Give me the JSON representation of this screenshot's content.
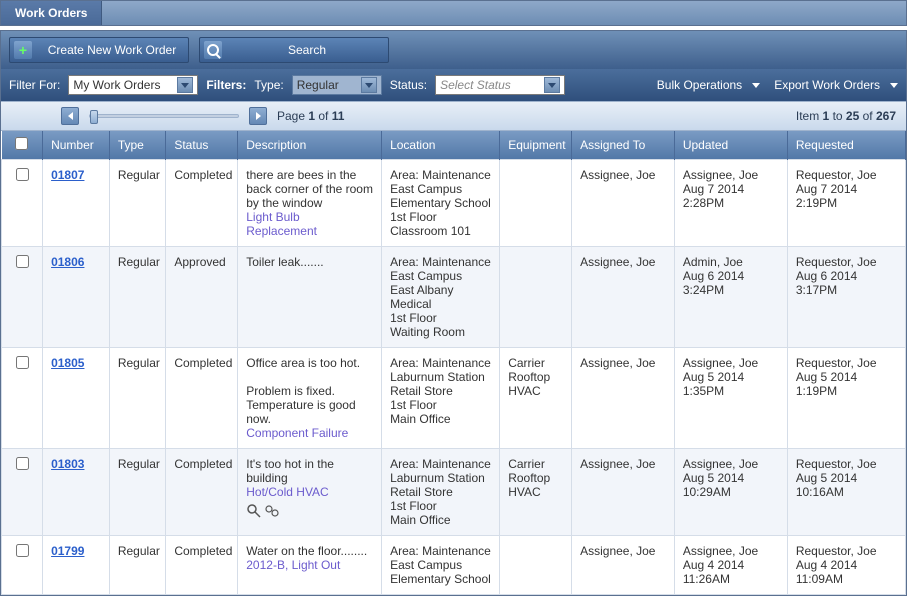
{
  "tab": {
    "title": "Work Orders"
  },
  "toolbar": {
    "create_label": "Create New Work Order",
    "search_label": "Search"
  },
  "filters": {
    "filter_for_label": "Filter For:",
    "filter_for_value": "My Work Orders",
    "filters_label": "Filters:",
    "type_label": "Type:",
    "type_value": "Regular",
    "status_label": "Status:",
    "status_placeholder": "Select Status",
    "bulk_label": "Bulk Operations",
    "export_label": "Export Work Orders"
  },
  "pager": {
    "page_prefix": "Page ",
    "page_current": "1",
    "page_of": " of ",
    "page_total": "11",
    "item_prefix": "Item ",
    "item_from": "1",
    "item_to_label": " to ",
    "item_to": "25",
    "item_of_label": " of ",
    "item_total": "267"
  },
  "columns": {
    "number": "Number",
    "type": "Type",
    "status": "Status",
    "description": "Description",
    "location": "Location",
    "equipment": "Equipment",
    "assigned": "Assigned To",
    "updated": "Updated",
    "requested": "Requested"
  },
  "rows": [
    {
      "number": "01807",
      "type": "Regular",
      "status": "Completed",
      "desc": "there are bees in the back corner of the room by the window",
      "desc_link": "Light Bulb Replacement",
      "loc": "Area: Maintenance\nEast Campus\nElementary School\n1st Floor\nClassroom 101",
      "equipment": "",
      "assigned": "Assignee, Joe",
      "updated": "Assignee, Joe\nAug 7 2014\n2:28PM",
      "requested": "Requestor, Joe\nAug 7 2014\n2:19PM",
      "has_attach": false
    },
    {
      "number": "01806",
      "type": "Regular",
      "status": "Approved",
      "desc": "Toiler leak.......",
      "desc_link": "",
      "loc": "Area: Maintenance\nEast Campus\nEast Albany Medical\n1st Floor\nWaiting Room",
      "equipment": "",
      "assigned": "Assignee, Joe",
      "updated": "Admin, Joe\nAug 6 2014\n3:24PM",
      "requested": "Requestor, Joe\nAug 6 2014\n3:17PM",
      "has_attach": false
    },
    {
      "number": "01805",
      "type": "Regular",
      "status": "Completed",
      "desc": "Office area is too hot.\n\nProblem is fixed.\n Temperature is good now.",
      "desc_link": "Component Failure",
      "loc": "Area: Maintenance\nLaburnum Station\nRetail Store\n1st Floor\nMain Office",
      "equipment": "Carrier Rooftop HVAC",
      "assigned": "Assignee, Joe",
      "updated": "Assignee, Joe\nAug 5 2014\n1:35PM",
      "requested": "Requestor, Joe\nAug 5 2014\n1:19PM",
      "has_attach": false
    },
    {
      "number": "01803",
      "type": "Regular",
      "status": "Completed",
      "desc": "It's too hot in the building",
      "desc_link": "Hot/Cold HVAC",
      "loc": "Area: Maintenance\nLaburnum Station\nRetail Store\n1st Floor\nMain Office",
      "equipment": "Carrier Rooftop HVAC",
      "assigned": "Assignee, Joe",
      "updated": "Assignee, Joe\nAug 5 2014\n10:29AM",
      "requested": "Requestor, Joe\nAug 5 2014\n10:16AM",
      "has_attach": true
    },
    {
      "number": "01799",
      "type": "Regular",
      "status": "Completed",
      "desc": "Water on the floor........",
      "desc_link": "2012-B, Light Out",
      "loc": "Area: Maintenance\nEast Campus\nElementary School",
      "equipment": "",
      "assigned": "Assignee, Joe",
      "updated": "Assignee, Joe\nAug 4 2014\n11:26AM",
      "requested": "Requestor, Joe\nAug 4 2014\n11:09AM",
      "has_attach": false
    }
  ]
}
